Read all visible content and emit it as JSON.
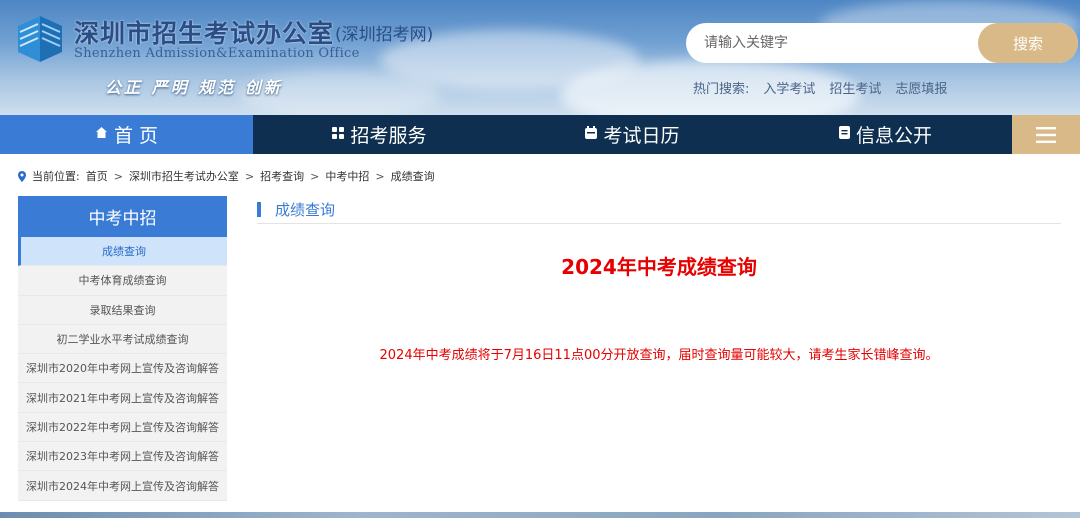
{
  "header": {
    "title": "深圳市招生考试办公室",
    "subtitle": "(深圳招考网)",
    "title_en": "Shenzhen Admission&Examination Office",
    "slogan": "公正 严明 规范 创新",
    "logo_icon": "building-logo-icon"
  },
  "search": {
    "placeholder": "请输入关键字",
    "button_label": "搜索",
    "hot_label": "热门搜索:",
    "hot_terms": [
      "入学考试",
      "招生考试",
      "志愿填报"
    ]
  },
  "nav": {
    "items": [
      {
        "label": "首 页",
        "icon": "home-icon",
        "active": true
      },
      {
        "label": "招考服务",
        "icon": "grid-icon",
        "active": false
      },
      {
        "label": "考试日历",
        "icon": "calendar-icon",
        "active": false
      },
      {
        "label": "信息公开",
        "icon": "document-icon",
        "active": false
      }
    ],
    "menu_icon": "hamburger-menu-icon"
  },
  "breadcrumb": {
    "prefix": "当前位置:",
    "items": [
      "首页",
      "深圳市招生考试办公室",
      "招考查询",
      "中考中招",
      "成绩查询"
    ]
  },
  "sidebar": {
    "title": "中考中招",
    "items": [
      {
        "label": "成绩查询",
        "active": true
      },
      {
        "label": "中考体育成绩查询"
      },
      {
        "label": "录取结果查询"
      },
      {
        "label": "初二学业水平考试成绩查询"
      },
      {
        "label": "深圳市2020年中考网上宣传及咨询解答"
      },
      {
        "label": "深圳市2021年中考网上宣传及咨询解答"
      },
      {
        "label": "深圳市2022年中考网上宣传及咨询解答"
      },
      {
        "label": "深圳市2023年中考网上宣传及咨询解答"
      },
      {
        "label": "深圳市2024年中考网上宣传及咨询解答"
      }
    ]
  },
  "main": {
    "section_label": "成绩查询",
    "title": "2024年中考成绩查询",
    "notice": "2024年中考成绩将于7月16日11点00分开放查询，届时查询量可能较大，请考生家长错峰查询。"
  },
  "colors": {
    "accent_blue": "#3a7bd5",
    "nav_dark": "#0e2f4f",
    "gold": "#d9b987",
    "alert_red": "#e60000"
  }
}
